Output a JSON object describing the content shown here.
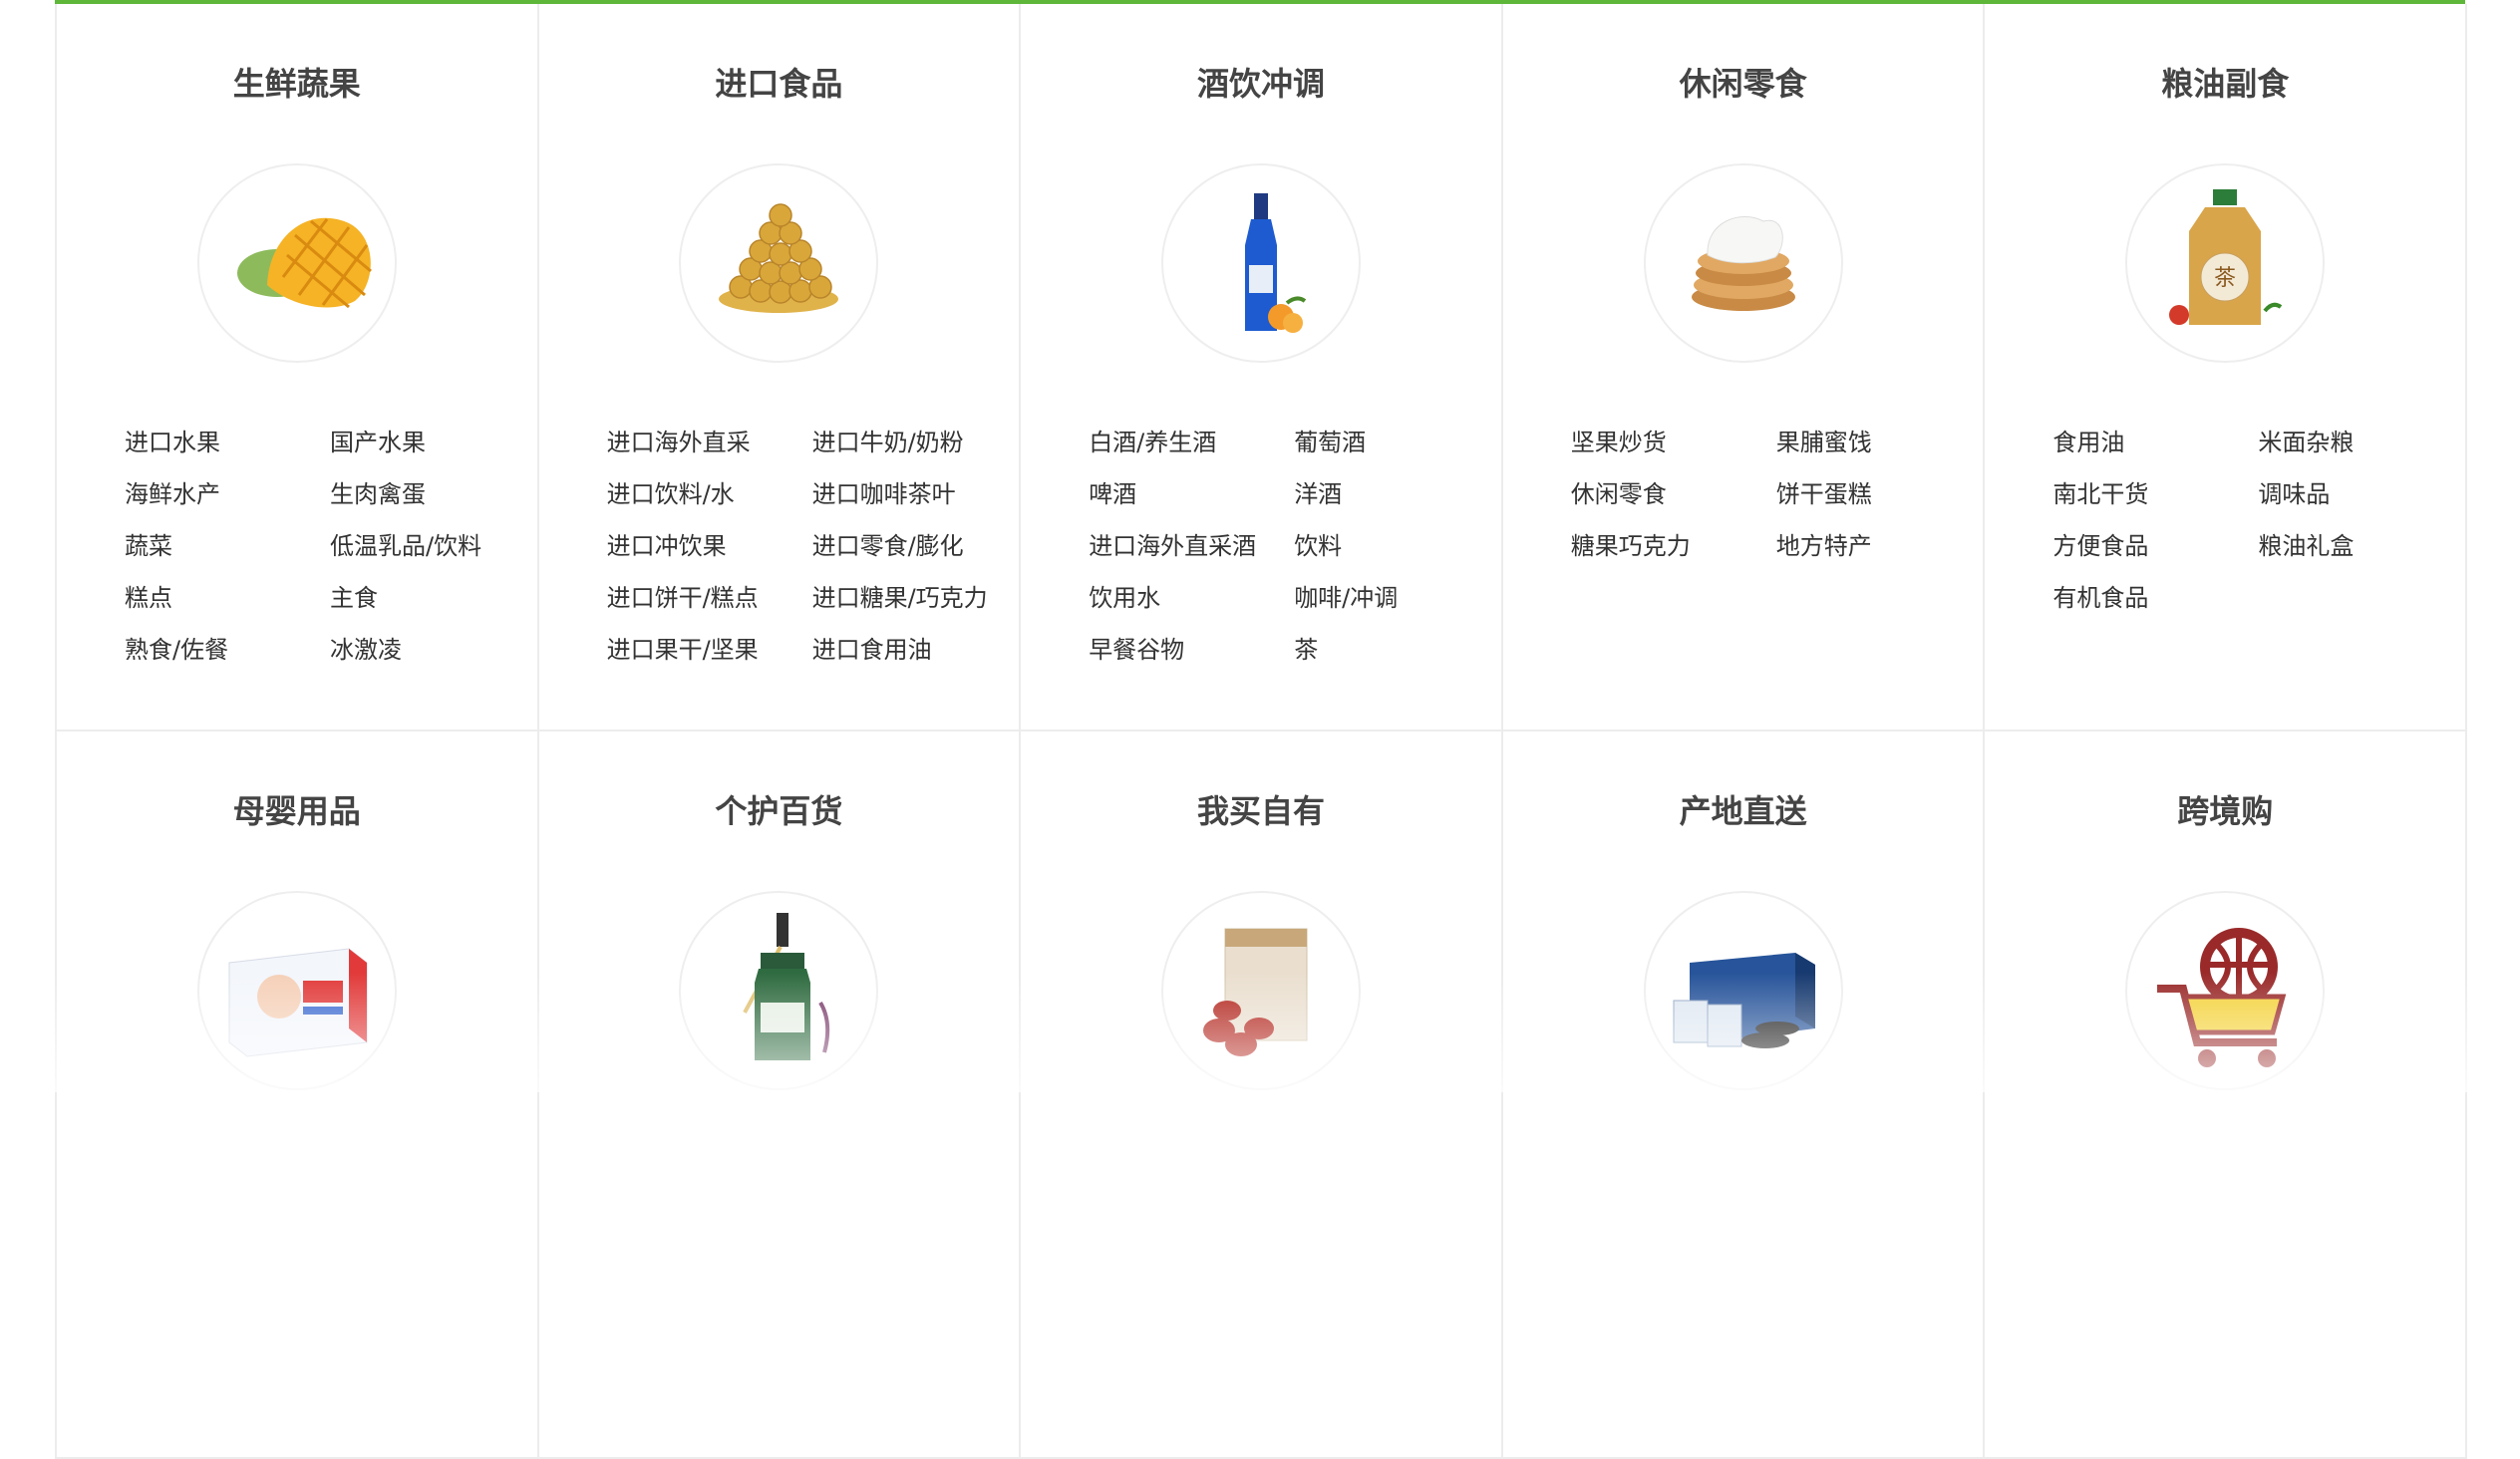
{
  "accent_color": "#5fb73a",
  "categories": [
    {
      "title": "生鲜蔬果",
      "icon": "mango-icon",
      "links": [
        "进口水果",
        "国产水果",
        "海鲜水产",
        "生肉禽蛋",
        "蔬菜",
        "低温乳品/饮料",
        "糕点",
        "主食",
        "熟食/佐餐",
        "冰激凌"
      ]
    },
    {
      "title": "进口食品",
      "icon": "chocolate-balls-icon",
      "links": [
        "进口海外直采",
        "进口牛奶/奶粉",
        "进口饮料/水",
        "进口咖啡茶叶",
        "进口冲饮果",
        "进口零食/膨化",
        "进口饼干/糕点",
        "进口糖果/巧克力",
        "进口果干/坚果",
        "进口食用油"
      ]
    },
    {
      "title": "酒饮冲调",
      "icon": "liquor-bottle-icon",
      "links": [
        "白酒/养生酒",
        "葡萄酒",
        "啤酒",
        "洋酒",
        "进口海外直采酒",
        "饮料",
        "饮用水",
        "咖啡/冲调",
        "早餐谷物",
        "茶"
      ]
    },
    {
      "title": "休闲零食",
      "icon": "pancake-stack-icon",
      "links": [
        "坚果炒货",
        "果脯蜜饯",
        "休闲零食",
        "饼干蛋糕",
        "糖果巧克力",
        "地方特产"
      ]
    },
    {
      "title": "粮油副食",
      "icon": "oil-bottle-icon",
      "links": [
        "食用油",
        "米面杂粮",
        "南北干货",
        "调味品",
        "方便食品",
        "粮油礼盒",
        "有机食品"
      ]
    },
    {
      "title": "母婴用品",
      "icon": "diaper-pack-icon",
      "links": []
    },
    {
      "title": "个护百货",
      "icon": "serum-bottle-icon",
      "links": []
    },
    {
      "title": "我买自有",
      "icon": "jujube-bag-icon",
      "links": []
    },
    {
      "title": "产地直送",
      "icon": "seafood-box-icon",
      "links": []
    },
    {
      "title": "跨境购",
      "icon": "shopping-cart-icon",
      "links": []
    }
  ]
}
